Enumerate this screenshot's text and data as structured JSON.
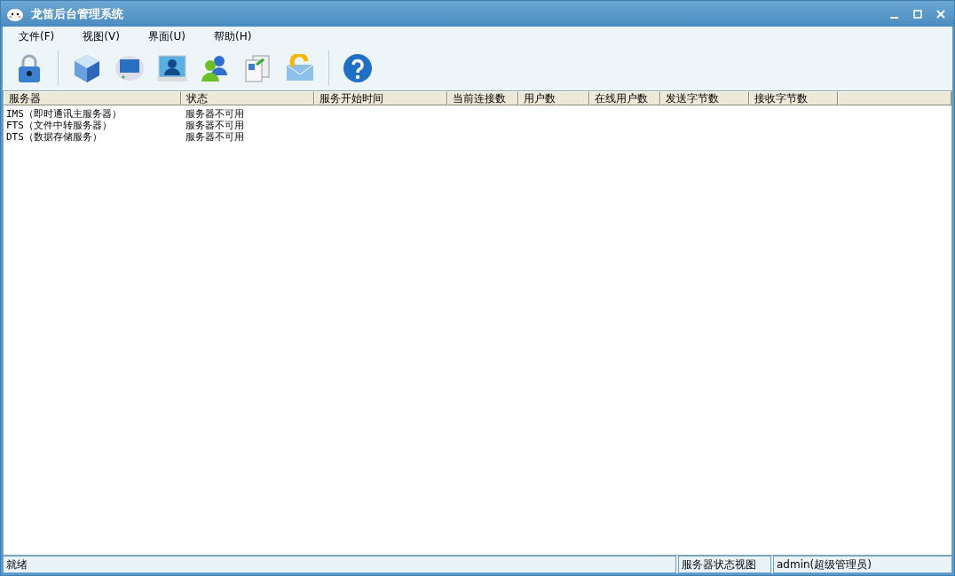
{
  "window": {
    "title": "龙笛后台管理系统"
  },
  "menu": [
    {
      "label": "文件(F)"
    },
    {
      "label": "视图(V)"
    },
    {
      "label": "界面(U)"
    },
    {
      "label": "帮助(H)"
    }
  ],
  "toolbar": [
    {
      "kind": "lock"
    },
    {
      "kind": "separator"
    },
    {
      "kind": "cube"
    },
    {
      "kind": "monitor"
    },
    {
      "kind": "user-card"
    },
    {
      "kind": "users"
    },
    {
      "kind": "documents"
    },
    {
      "kind": "mail"
    },
    {
      "kind": "separator"
    },
    {
      "kind": "help"
    }
  ],
  "table": {
    "columns": [
      "服务器",
      "状态",
      "服务开始时间",
      "当前连接数",
      "用户数",
      "在线用户数",
      "发送字节数",
      "接收字节数"
    ],
    "rows": [
      {
        "cells": [
          "IMS（即时通讯主服务器）",
          "服务器不可用"
        ]
      },
      {
        "cells": [
          "FTS（文件中转服务器）",
          "服务器不可用"
        ]
      },
      {
        "cells": [
          "DTS（数据存储服务）",
          "服务器不可用"
        ]
      }
    ]
  },
  "status_bar": [
    "就绪",
    "服务器状态视图",
    "admin(超级管理员)"
  ]
}
